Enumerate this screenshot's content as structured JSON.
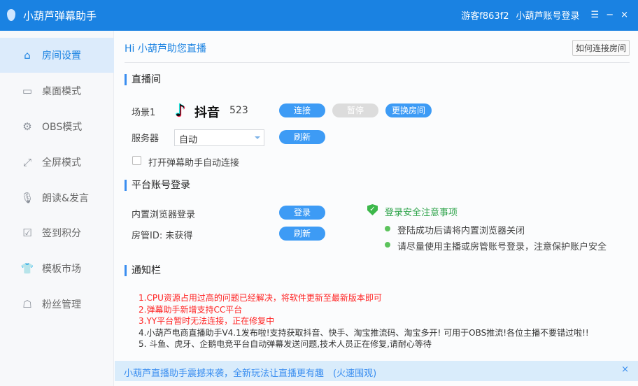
{
  "app": {
    "title": "小葫芦弹幕助手",
    "guest": "游客f863f2",
    "account_login": "小葫芦账号登录",
    "menu_icon": "☰",
    "min_icon": "−",
    "close_icon": "×"
  },
  "sidebar": {
    "items": [
      {
        "label": "房间设置",
        "icon": "⌂",
        "active": true
      },
      {
        "label": "桌面模式",
        "icon": "▭"
      },
      {
        "label": "OBS模式",
        "icon": "⚙"
      },
      {
        "label": "全屏模式",
        "icon": "⤢"
      },
      {
        "label": "朗读&发言",
        "icon": "🎙"
      },
      {
        "label": "签到积分",
        "icon": "☑"
      },
      {
        "label": "模板市场",
        "icon": "👕"
      },
      {
        "label": "粉丝管理",
        "icon": "☖"
      }
    ]
  },
  "header": {
    "greeting": "Hi 小葫芦助您直播",
    "how_connect": "如何连接房间"
  },
  "live_room": {
    "title": "直播间",
    "scene": "场景1",
    "platform": "抖音",
    "room_id": "523",
    "connect": "连接",
    "pause": "暂停",
    "change_room": "更换房间",
    "server_label": "服务器",
    "server_value": "自动",
    "refresh": "刷新",
    "auto_connect": "打开弹幕助手自动连接",
    "auto_connect_checked": false
  },
  "platform_login": {
    "title": "平台账号登录",
    "browser_login": "内置浏览器登录",
    "login": "登录",
    "manager_id": "房管ID: 未获得",
    "refresh": "刷新",
    "safety_title": "登录安全注意事项",
    "tips": [
      "登陆成功后请将内置浏览器关闭",
      "请尽量使用主播或房管账号登录，注意保护账户安全"
    ]
  },
  "notice": {
    "title": "通知栏",
    "items": [
      "1.CPU资源占用过高的问题已经解决，将软件更新至最新版本即可",
      "2.弹幕助手新增支持CC平台",
      "3.YY平台暂时无法连接，正在修复中",
      "4.小葫芦电商直播助手V4.1发布啦!支持获取抖音、快手、淘宝推流码、淘宝多开!  可用于OBS推流!各位主播不要错过啦!!",
      "5. 斗鱼、虎牙、企鹅电竞平台自动弹幕发送问题,技术人员正在修复,请耐心等待"
    ]
  },
  "banner": {
    "text": "小葫芦直播助手震撼来袭，全新玩法让直播更有趣　(火速围观)",
    "close": "×"
  },
  "colors": {
    "brand": "#1a82e2",
    "button": "#3d9bf5",
    "notice_red": "#ff2222"
  }
}
